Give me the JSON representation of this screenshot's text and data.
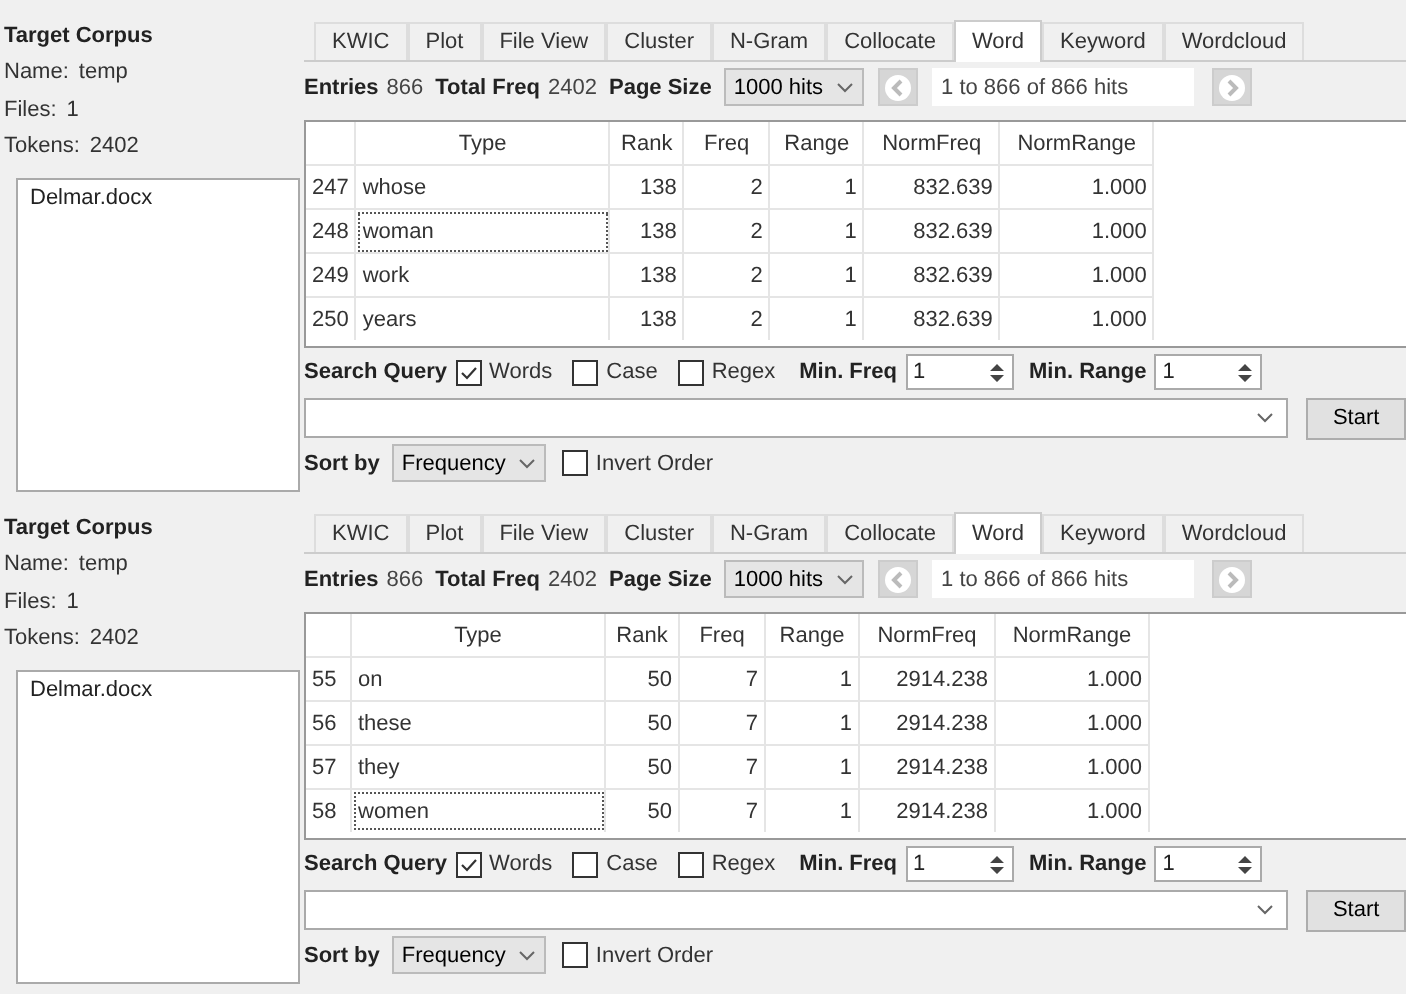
{
  "panels": [
    {
      "corpus": {
        "title": "Target Corpus",
        "name_label": "Name:",
        "name": "temp",
        "files_label": "Files:",
        "files": "1",
        "tokens_label": "Tokens:",
        "tokens": "2402",
        "files_list": [
          "Delmar.docx"
        ]
      },
      "tabs": [
        {
          "label": "KWIC",
          "selected": false
        },
        {
          "label": "Plot",
          "selected": false
        },
        {
          "label": "File View",
          "selected": false
        },
        {
          "label": "Cluster",
          "selected": false
        },
        {
          "label": "N-Gram",
          "selected": false
        },
        {
          "label": "Collocate",
          "selected": false
        },
        {
          "label": "Word",
          "selected": true
        },
        {
          "label": "Keyword",
          "selected": false
        },
        {
          "label": "Wordcloud",
          "selected": false
        }
      ],
      "summary": {
        "entries_label": "Entries",
        "entries": "866",
        "total_label": "Total Freq",
        "total": "2402",
        "page_size_label": "Page Size",
        "page_size": "1000 hits",
        "hits": "1 to 866 of 866 hits"
      },
      "table": {
        "columns": [
          "Type",
          "Rank",
          "Freq",
          "Range",
          "NormFreq",
          "NormRange"
        ],
        "rows": [
          {
            "index": "247",
            "cells": [
              "whose",
              "138",
              "2",
              "1",
              "832.639",
              "1.000"
            ],
            "focused": false
          },
          {
            "index": "248",
            "cells": [
              "woman",
              "138",
              "2",
              "1",
              "832.639",
              "1.000"
            ],
            "focused": true
          },
          {
            "index": "249",
            "cells": [
              "work",
              "138",
              "2",
              "1",
              "832.639",
              "1.000"
            ],
            "focused": false
          },
          {
            "index": "250",
            "cells": [
              "years",
              "138",
              "2",
              "1",
              "832.639",
              "1.000"
            ],
            "focused": false
          }
        ]
      },
      "search": {
        "label": "Search Query",
        "options": [
          {
            "label": "Words",
            "checked": true
          },
          {
            "label": "Case",
            "checked": false
          },
          {
            "label": "Regex",
            "checked": false
          }
        ],
        "min_freq_label": "Min. Freq",
        "min_freq": "1",
        "min_range_label": "Min. Range",
        "min_range": "1",
        "start": "Start"
      },
      "sort": {
        "label": "Sort by",
        "value": "Frequency",
        "invert_label": "Invert Order",
        "invert": false
      }
    },
    {
      "corpus": {
        "title": "Target Corpus",
        "name_label": "Name:",
        "name": "temp",
        "files_label": "Files:",
        "files": "1",
        "tokens_label": "Tokens:",
        "tokens": "2402",
        "files_list": [
          "Delmar.docx"
        ]
      },
      "tabs": [
        {
          "label": "KWIC",
          "selected": false
        },
        {
          "label": "Plot",
          "selected": false
        },
        {
          "label": "File View",
          "selected": false
        },
        {
          "label": "Cluster",
          "selected": false
        },
        {
          "label": "N-Gram",
          "selected": false
        },
        {
          "label": "Collocate",
          "selected": false
        },
        {
          "label": "Word",
          "selected": true
        },
        {
          "label": "Keyword",
          "selected": false
        },
        {
          "label": "Wordcloud",
          "selected": false
        }
      ],
      "summary": {
        "entries_label": "Entries",
        "entries": "866",
        "total_label": "Total Freq",
        "total": "2402",
        "page_size_label": "Page Size",
        "page_size": "1000 hits",
        "hits": "1 to 866 of 866 hits"
      },
      "table": {
        "columns": [
          "Type",
          "Rank",
          "Freq",
          "Range",
          "NormFreq",
          "NormRange"
        ],
        "rows": [
          {
            "index": "55",
            "cells": [
              "on",
              "50",
              "7",
              "1",
              "2914.238",
              "1.000"
            ],
            "focused": false
          },
          {
            "index": "56",
            "cells": [
              "these",
              "50",
              "7",
              "1",
              "2914.238",
              "1.000"
            ],
            "focused": false
          },
          {
            "index": "57",
            "cells": [
              "they",
              "50",
              "7",
              "1",
              "2914.238",
              "1.000"
            ],
            "focused": false
          },
          {
            "index": "58",
            "cells": [
              "women",
              "50",
              "7",
              "1",
              "2914.238",
              "1.000"
            ],
            "focused": true
          }
        ]
      },
      "search": {
        "label": "Search Query",
        "options": [
          {
            "label": "Words",
            "checked": true
          },
          {
            "label": "Case",
            "checked": false
          },
          {
            "label": "Regex",
            "checked": false
          }
        ],
        "min_freq_label": "Min. Freq",
        "min_freq": "1",
        "min_range_label": "Min. Range",
        "min_range": "1",
        "start": "Start"
      },
      "sort": {
        "label": "Sort by",
        "value": "Frequency",
        "invert_label": "Invert Order",
        "invert": false
      }
    }
  ]
}
